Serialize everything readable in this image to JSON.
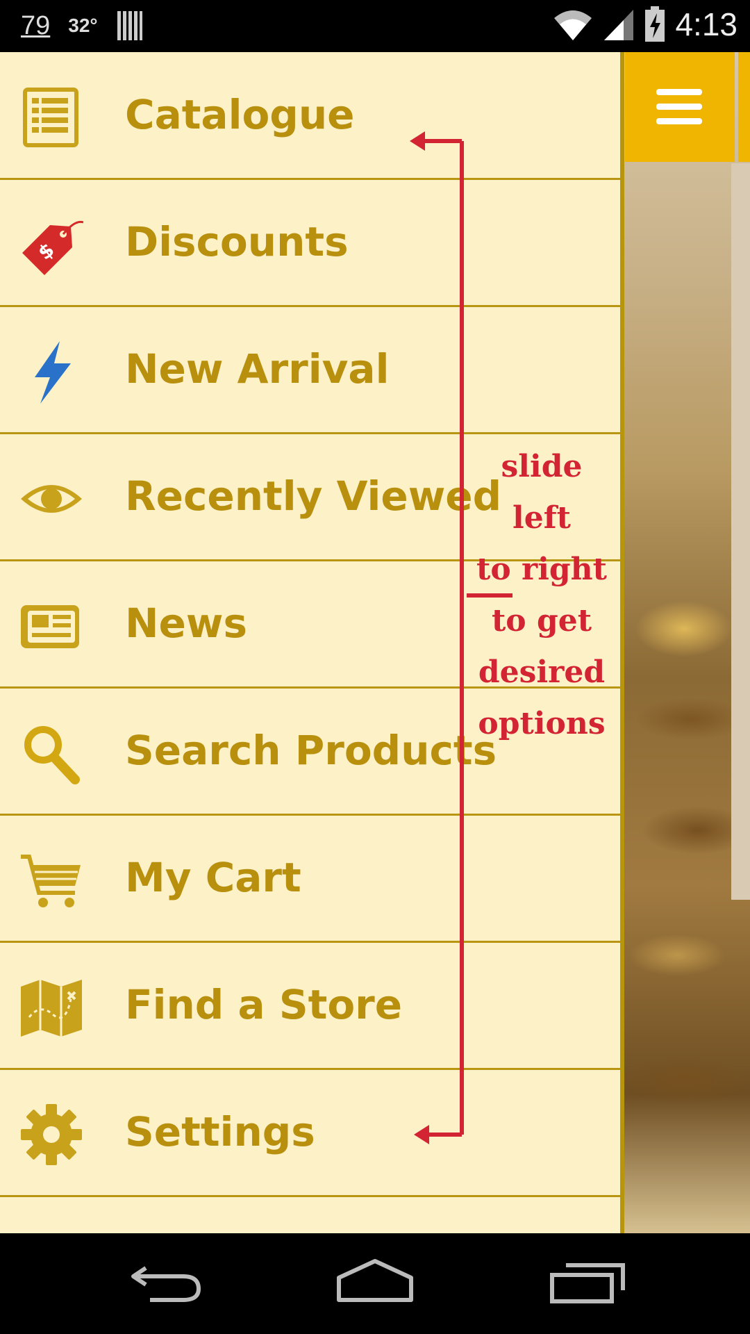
{
  "status_bar": {
    "left_items": [
      "79",
      "32°"
    ],
    "time": "4:13"
  },
  "drawer": {
    "items": [
      {
        "label": "Catalogue",
        "icon": "catalogue-list-icon"
      },
      {
        "label": "Discounts",
        "icon": "price-tag-icon"
      },
      {
        "label": "New Arrival",
        "icon": "lightning-bolt-icon"
      },
      {
        "label": "Recently Viewed",
        "icon": "eye-icon"
      },
      {
        "label": "News",
        "icon": "newspaper-icon"
      },
      {
        "label": "Search Products",
        "icon": "magnifier-icon"
      },
      {
        "label": "My Cart",
        "icon": "shopping-cart-icon"
      },
      {
        "label": "Find a Store",
        "icon": "map-icon"
      },
      {
        "label": "Settings",
        "icon": "gear-icon"
      }
    ]
  },
  "annotation": {
    "lines": [
      "slide",
      "left",
      "to right",
      "to get",
      "desired",
      "options"
    ],
    "color": "#d32433"
  },
  "app_bar": {
    "menu_icon": "hamburger-menu-icon",
    "color": "#f0b500"
  },
  "nav_bar": {
    "buttons": [
      "back-icon",
      "home-icon",
      "recent-apps-icon"
    ]
  },
  "colors": {
    "drawer_bg": "#fdf1c8",
    "label": "#b8900e",
    "divider": "#b89612"
  }
}
